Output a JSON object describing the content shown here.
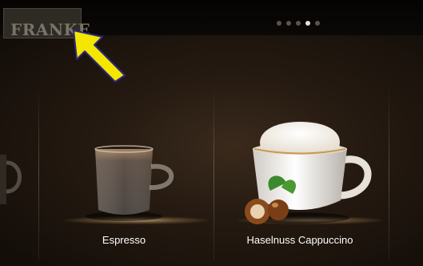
{
  "brand": {
    "logo_text": "FRANKE"
  },
  "carousel": {
    "page_count": 5,
    "active_page": 4
  },
  "products": [
    {
      "label": "Espresso",
      "icon": "espresso-cup-icon"
    },
    {
      "label": "Haselnuss Cappuccino",
      "icon": "cappuccino-cup-icon"
    }
  ],
  "annotation": {
    "arrow_color": "#f5e600"
  }
}
